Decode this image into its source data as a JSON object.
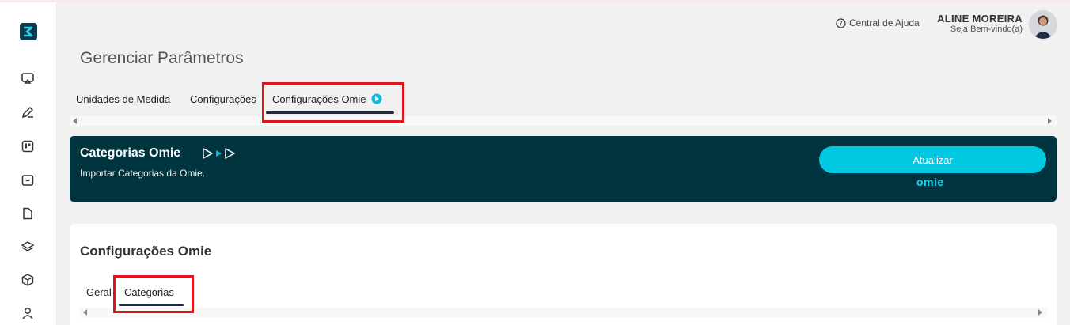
{
  "header": {
    "help_label": "Central de Ajuda",
    "user_name": "ALINE MOREIRA",
    "user_greeting": "Seja Bem-vindo(a)"
  },
  "page": {
    "title": "Gerenciar Parâmetros"
  },
  "tabs": [
    {
      "label": "Unidades de Medida"
    },
    {
      "label": "Configurações"
    },
    {
      "label": "Configurações Omie",
      "active": true
    }
  ],
  "banner": {
    "title": "Categorias Omie",
    "subtitle": "Importar Categorias da Omie.",
    "button_label": "Atualizar",
    "brand": "omie"
  },
  "card": {
    "title": "Configurações Omie",
    "subtabs": [
      {
        "label": "Geral"
      },
      {
        "label": "Categorias",
        "active": true
      }
    ]
  },
  "sidebar": {
    "icons": [
      "logo-icon",
      "monitor-icon",
      "pencil-icon",
      "board-icon",
      "inbox-icon",
      "file-icon",
      "layers-icon",
      "box-icon",
      "user-icon"
    ]
  },
  "colors": {
    "banner_bg": "#003540",
    "accent": "#00c8e0",
    "highlight": "#e0141c"
  }
}
